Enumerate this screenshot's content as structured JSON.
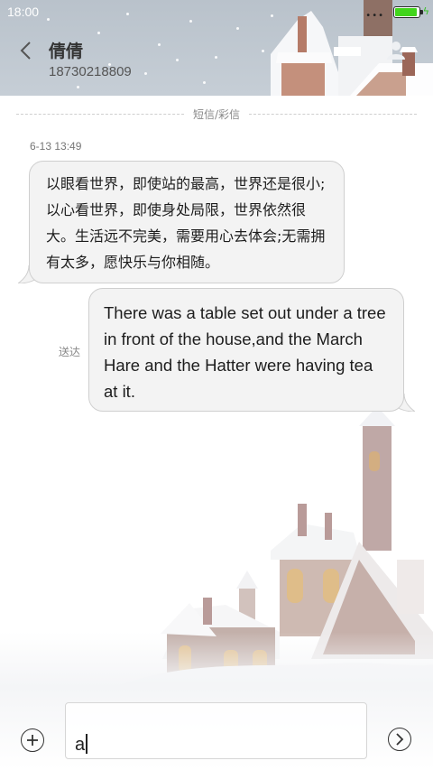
{
  "status_bar": {
    "time": "18:00",
    "signal_dots": "•••",
    "battery_icon": "battery-charging-icon",
    "battery_color": "#41d51c",
    "battery_level": 0.95
  },
  "header": {
    "back_icon": "chevron-left-icon",
    "contact_name": "倩倩",
    "contact_number": "18730218809",
    "contact_icon": "person-icon"
  },
  "conversation": {
    "type_label": "短信/彩信",
    "messages": [
      {
        "direction": "incoming",
        "time": "6-13 13:49",
        "text": "以眼看世界，即使站的最高，世界还是很小;以心看世界，即使身处局限，世界依然很大。生活远不完美，需要用心去体会;无需拥有太多，愿快乐与你相随。"
      },
      {
        "direction": "outgoing",
        "status": "送达",
        "text": "There was a table set out under a tree in front of the house,and the March Hare and the Hatter were having tea at it."
      }
    ]
  },
  "composer": {
    "add_icon": "plus-circle-icon",
    "input_value": "a",
    "send_icon": "chevron-right-circle-icon"
  }
}
